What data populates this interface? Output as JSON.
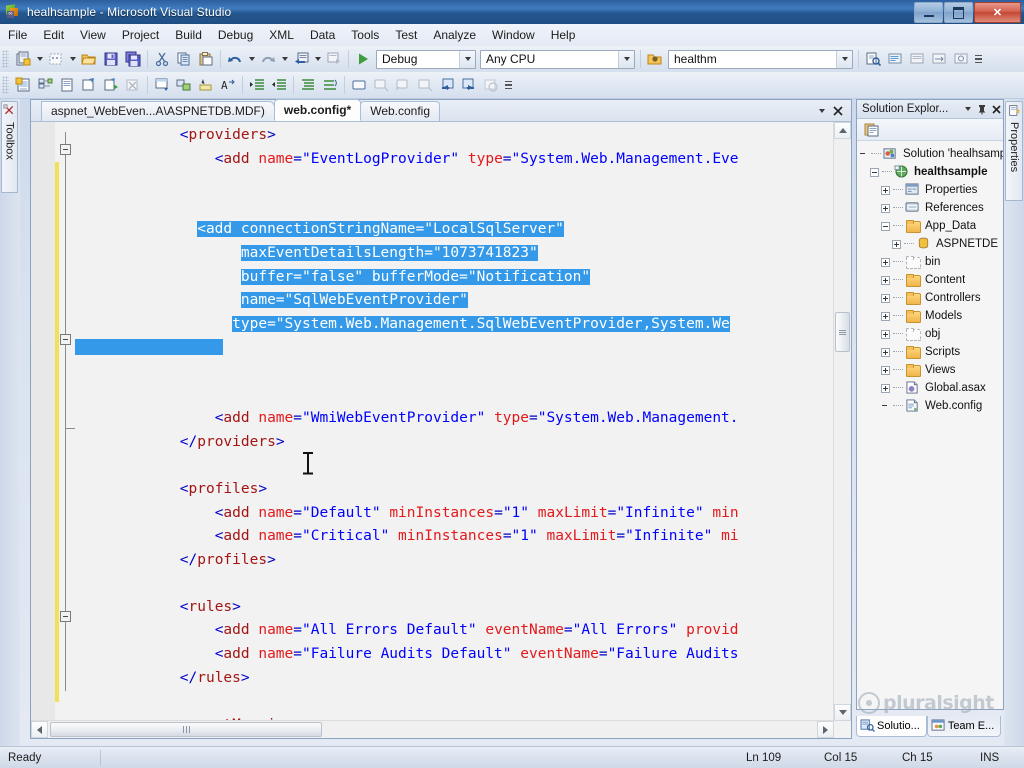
{
  "window": {
    "title": "healhsample - Microsoft Visual Studio",
    "icon": "visual-studio-icon",
    "minimize_label": "",
    "maximize_label": "",
    "close_label": "✕"
  },
  "menubar": {
    "items": [
      "File",
      "Edit",
      "View",
      "Project",
      "Build",
      "Debug",
      "XML",
      "Data",
      "Tools",
      "Test",
      "Analyze",
      "Window",
      "Help"
    ]
  },
  "toolbar": {
    "config_combo": {
      "value": "Debug"
    },
    "platform_combo": {
      "value": "Any CPU"
    },
    "startup_combo": {
      "value": "healthm"
    },
    "row1_icons": [
      "new-project-icon",
      "add-item-icon",
      "open-file-icon",
      "save-icon",
      "save-all-icon",
      "cut-icon",
      "copy-icon",
      "paste-icon",
      "undo-icon",
      "redo-icon",
      "navigate-backward-icon",
      "navigate-forward-icon",
      "start-debug-icon"
    ],
    "row2_icons": [
      "new-query-icon",
      "object-explorer-icon",
      "properties-window-icon",
      "run-icon",
      "execute-icon",
      "stop-icon",
      "toolbox-icon",
      "solution-explorer-icon",
      "find-icon",
      "comment-icon",
      "uncomment-icon",
      "indent-icon",
      "outdent-icon",
      "collapse-icon",
      "expand-icon",
      "rectangle-icon",
      "prev-bookmark-icon",
      "next-bookmark-icon",
      "clear-bookmark-icon",
      "step-in-icon",
      "step-out-icon",
      "stop-all-icon"
    ]
  },
  "left_dock": {
    "toolbox_label": "Toolbox",
    "toolbox_icon": "toolbox-icon"
  },
  "right_dock": {
    "properties_label": "Properties",
    "properties_icon": "properties-icon"
  },
  "editor": {
    "tabs": [
      {
        "label": "aspnet_WebEven...A\\ASPNETDB.MDF)",
        "active": false
      },
      {
        "label": "web.config*",
        "active": true
      },
      {
        "label": "Web.config",
        "active": false
      }
    ],
    "tab_dropdown_icon": "chevron-down-icon",
    "tab_close_icon": "close-icon",
    "code_lines": [
      {
        "indent": 12,
        "segments": [
          {
            "t": "ang",
            "s": "<"
          },
          {
            "t": "tag",
            "s": "providers"
          },
          {
            "t": "ang",
            "s": ">"
          }
        ]
      },
      {
        "indent": 16,
        "segments": [
          {
            "t": "ang",
            "s": "<"
          },
          {
            "t": "tag",
            "s": "add "
          },
          {
            "t": "attr",
            "s": "name"
          },
          {
            "t": "eq",
            "s": "="
          },
          {
            "t": "val",
            "s": "\"EventLogProvider\""
          },
          {
            "t": "plain",
            "s": " "
          },
          {
            "t": "attr",
            "s": "type"
          },
          {
            "t": "eq",
            "s": "="
          },
          {
            "t": "val",
            "s": "\"System.Web.Management.Eve"
          }
        ]
      },
      {
        "indent": 0,
        "segments": []
      },
      {
        "indent": 0,
        "segments": []
      },
      {
        "indent": 14,
        "selected": true,
        "segments": [
          {
            "t": "ang",
            "s": "<"
          },
          {
            "t": "tag",
            "s": "add "
          },
          {
            "t": "attr",
            "s": "connectionStringName"
          },
          {
            "t": "eq",
            "s": "="
          },
          {
            "t": "val",
            "s": "\"LocalSqlServer\""
          }
        ]
      },
      {
        "indent": 19,
        "selected": true,
        "segments": [
          {
            "t": "attr",
            "s": "maxEventDetailsLength"
          },
          {
            "t": "eq",
            "s": "="
          },
          {
            "t": "val",
            "s": "\"1073741823\""
          }
        ]
      },
      {
        "indent": 19,
        "selected": true,
        "segments": [
          {
            "t": "attr",
            "s": "buffer"
          },
          {
            "t": "eq",
            "s": "="
          },
          {
            "t": "val",
            "s": "\"false\""
          },
          {
            "t": "plain",
            "s": " "
          },
          {
            "t": "attr",
            "s": "bufferMode"
          },
          {
            "t": "eq",
            "s": "="
          },
          {
            "t": "val",
            "s": "\"Notification\""
          }
        ]
      },
      {
        "indent": 19,
        "selected": true,
        "segments": [
          {
            "t": "attr",
            "s": "name"
          },
          {
            "t": "eq",
            "s": "="
          },
          {
            "t": "val",
            "s": "\"SqlWebEventProvider\""
          }
        ]
      },
      {
        "indent": 18,
        "selected": true,
        "segments": [
          {
            "t": "attr",
            "s": "type"
          },
          {
            "t": "eq",
            "s": "="
          },
          {
            "t": "val",
            "s": "\"System.Web.Management.SqlWebEventProvider,System.We"
          }
        ]
      },
      {
        "indent": 0,
        "selected_partial": true,
        "segments": []
      },
      {
        "indent": 0,
        "segments": []
      },
      {
        "indent": 0,
        "segments": []
      },
      {
        "indent": 16,
        "segments": [
          {
            "t": "ang",
            "s": "<"
          },
          {
            "t": "tag",
            "s": "add "
          },
          {
            "t": "attr",
            "s": "name"
          },
          {
            "t": "eq",
            "s": "="
          },
          {
            "t": "val",
            "s": "\"WmiWebEventProvider\""
          },
          {
            "t": "plain",
            "s": " "
          },
          {
            "t": "attr",
            "s": "type"
          },
          {
            "t": "eq",
            "s": "="
          },
          {
            "t": "val",
            "s": "\"System.Web.Management."
          }
        ]
      },
      {
        "indent": 12,
        "segments": [
          {
            "t": "ang",
            "s": "</"
          },
          {
            "t": "tag",
            "s": "providers"
          },
          {
            "t": "ang",
            "s": ">"
          }
        ]
      },
      {
        "indent": 0,
        "segments": []
      },
      {
        "indent": 12,
        "segments": [
          {
            "t": "ang",
            "s": "<"
          },
          {
            "t": "tag",
            "s": "profiles"
          },
          {
            "t": "ang",
            "s": ">"
          }
        ]
      },
      {
        "indent": 16,
        "segments": [
          {
            "t": "ang",
            "s": "<"
          },
          {
            "t": "tag",
            "s": "add "
          },
          {
            "t": "attr",
            "s": "name"
          },
          {
            "t": "eq",
            "s": "="
          },
          {
            "t": "val",
            "s": "\"Default\""
          },
          {
            "t": "plain",
            "s": " "
          },
          {
            "t": "attr",
            "s": "minInstances"
          },
          {
            "t": "eq",
            "s": "="
          },
          {
            "t": "val",
            "s": "\"1\""
          },
          {
            "t": "plain",
            "s": " "
          },
          {
            "t": "attr",
            "s": "maxLimit"
          },
          {
            "t": "eq",
            "s": "="
          },
          {
            "t": "val",
            "s": "\"Infinite\""
          },
          {
            "t": "plain",
            "s": " "
          },
          {
            "t": "attr",
            "s": "min"
          }
        ]
      },
      {
        "indent": 16,
        "segments": [
          {
            "t": "ang",
            "s": "<"
          },
          {
            "t": "tag",
            "s": "add "
          },
          {
            "t": "attr",
            "s": "name"
          },
          {
            "t": "eq",
            "s": "="
          },
          {
            "t": "val",
            "s": "\"Critical\""
          },
          {
            "t": "plain",
            "s": " "
          },
          {
            "t": "attr",
            "s": "minInstances"
          },
          {
            "t": "eq",
            "s": "="
          },
          {
            "t": "val",
            "s": "\"1\""
          },
          {
            "t": "plain",
            "s": " "
          },
          {
            "t": "attr",
            "s": "maxLimit"
          },
          {
            "t": "eq",
            "s": "="
          },
          {
            "t": "val",
            "s": "\"Infinite\""
          },
          {
            "t": "plain",
            "s": " "
          },
          {
            "t": "attr",
            "s": "mi"
          }
        ]
      },
      {
        "indent": 12,
        "segments": [
          {
            "t": "ang",
            "s": "</"
          },
          {
            "t": "tag",
            "s": "profiles"
          },
          {
            "t": "ang",
            "s": ">"
          }
        ]
      },
      {
        "indent": 0,
        "segments": []
      },
      {
        "indent": 12,
        "segments": [
          {
            "t": "ang",
            "s": "<"
          },
          {
            "t": "tag",
            "s": "rules"
          },
          {
            "t": "ang",
            "s": ">"
          }
        ]
      },
      {
        "indent": 16,
        "segments": [
          {
            "t": "ang",
            "s": "<"
          },
          {
            "t": "tag",
            "s": "add "
          },
          {
            "t": "attr",
            "s": "name"
          },
          {
            "t": "eq",
            "s": "="
          },
          {
            "t": "val",
            "s": "\"All Errors Default\""
          },
          {
            "t": "plain",
            "s": " "
          },
          {
            "t": "attr",
            "s": "eventName"
          },
          {
            "t": "eq",
            "s": "="
          },
          {
            "t": "val",
            "s": "\"All Errors\""
          },
          {
            "t": "plain",
            "s": " "
          },
          {
            "t": "attr",
            "s": "provid"
          }
        ]
      },
      {
        "indent": 16,
        "segments": [
          {
            "t": "ang",
            "s": "<"
          },
          {
            "t": "tag",
            "s": "add "
          },
          {
            "t": "attr",
            "s": "name"
          },
          {
            "t": "eq",
            "s": "="
          },
          {
            "t": "val",
            "s": "\"Failure Audits Default\""
          },
          {
            "t": "plain",
            "s": " "
          },
          {
            "t": "attr",
            "s": "eventName"
          },
          {
            "t": "eq",
            "s": "="
          },
          {
            "t": "val",
            "s": "\"Failure Audits"
          }
        ]
      },
      {
        "indent": 12,
        "segments": [
          {
            "t": "ang",
            "s": "</"
          },
          {
            "t": "tag",
            "s": "rules"
          },
          {
            "t": "ang",
            "s": ">"
          }
        ]
      },
      {
        "indent": 0,
        "segments": []
      },
      {
        "indent": 12,
        "segments": [
          {
            "t": "ang",
            "s": "<"
          },
          {
            "t": "tag",
            "s": "eventMappings"
          },
          {
            "t": "ang",
            "s": ">"
          }
        ]
      }
    ]
  },
  "solution_explorer": {
    "title": "Solution Explor...",
    "dropdown_icon": "chevron-down-icon",
    "pin_icon": "pin-icon",
    "close_icon": "close-icon",
    "toolbar_icon": "properties-pages-icon",
    "tree": [
      {
        "depth": 0,
        "expander": "none",
        "icon": "solution-icon",
        "label": "Solution 'healhsample",
        "bold": false
      },
      {
        "depth": 1,
        "expander": "minus",
        "icon": "project-icon",
        "label": "healthsample",
        "bold": true
      },
      {
        "depth": 2,
        "expander": "plus",
        "icon": "properties-icon",
        "label": "Properties",
        "bold": false
      },
      {
        "depth": 2,
        "expander": "plus",
        "icon": "references-icon",
        "label": "References",
        "bold": false
      },
      {
        "depth": 2,
        "expander": "minus",
        "icon": "folder-icon",
        "label": "App_Data",
        "bold": false
      },
      {
        "depth": 3,
        "expander": "plus",
        "icon": "database-icon",
        "label": "ASPNETDE",
        "bold": false
      },
      {
        "depth": 2,
        "expander": "plus",
        "icon": "folder-empty-icon",
        "label": "bin",
        "bold": false
      },
      {
        "depth": 2,
        "expander": "plus",
        "icon": "folder-icon",
        "label": "Content",
        "bold": false
      },
      {
        "depth": 2,
        "expander": "plus",
        "icon": "folder-icon",
        "label": "Controllers",
        "bold": false
      },
      {
        "depth": 2,
        "expander": "plus",
        "icon": "folder-icon",
        "label": "Models",
        "bold": false
      },
      {
        "depth": 2,
        "expander": "plus",
        "icon": "folder-empty-icon",
        "label": "obj",
        "bold": false
      },
      {
        "depth": 2,
        "expander": "plus",
        "icon": "folder-icon",
        "label": "Scripts",
        "bold": false
      },
      {
        "depth": 2,
        "expander": "plus",
        "icon": "folder-icon",
        "label": "Views",
        "bold": false
      },
      {
        "depth": 2,
        "expander": "plus",
        "icon": "global-asax-icon",
        "label": "Global.asax",
        "bold": false
      },
      {
        "depth": 2,
        "expander": "none",
        "icon": "config-file-icon",
        "label": "Web.config",
        "bold": false
      }
    ]
  },
  "watermark": {
    "text": "pluralsight",
    "icon": "pluralsight-logo-icon"
  },
  "bottom_tabs": [
    {
      "label": "Solutio...",
      "icon": "solution-explorer-icon",
      "active": true
    },
    {
      "label": "Team E...",
      "icon": "team-explorer-icon",
      "active": false
    }
  ],
  "statusbar": {
    "status": "Ready",
    "line": "Ln 109",
    "col": "Col 15",
    "ch": "Ch 15",
    "insert_mode": "INS"
  }
}
